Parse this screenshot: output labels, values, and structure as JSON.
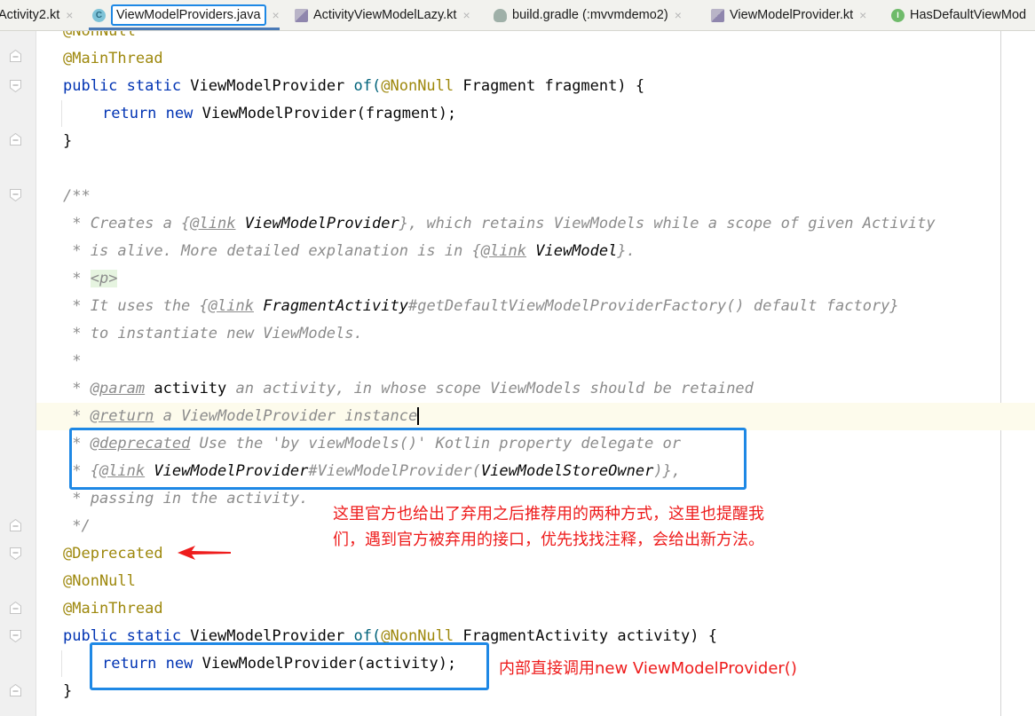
{
  "tabs": [
    {
      "label": "Activity2.kt",
      "icon": "kotlin-file-icon",
      "active": false
    },
    {
      "label": "ViewModelProviders.java",
      "icon": "java-class-icon",
      "active": true
    },
    {
      "label": "ActivityViewModelLazy.kt",
      "icon": "kotlin-file-icon",
      "active": false
    },
    {
      "label": "build.gradle (:mvvmdemo2)",
      "icon": "gradle-icon",
      "active": false
    },
    {
      "label": "ViewModelProvider.kt",
      "icon": "kotlin-file-icon",
      "active": false
    },
    {
      "label": "HasDefaultViewMod",
      "icon": "interface-icon",
      "active": false
    }
  ],
  "tab_close_glyph": "×",
  "icon_letters": {
    "class": "C",
    "interface": "I"
  },
  "code": {
    "l0": "@NonNull",
    "l1": "@MainThread",
    "l2": {
      "kw": "public static ",
      "type": "ViewModelProvider ",
      "fn": "of(",
      "ann": "@NonNull ",
      "rest": "Fragment fragment) {"
    },
    "l3": {
      "kw": "return new ",
      "rest": "ViewModelProvider(fragment);"
    },
    "l4": "}",
    "l6": "/**",
    "l7": {
      "a": " * Creates a {",
      "tag": "@link",
      "sp": " ",
      "ref": "ViewModelProvider",
      "b": "}, which retains ViewModels while a scope of given Activity"
    },
    "l8": {
      "a": " * is alive. More detailed explanation is in {",
      "tag": "@link",
      "sp": " ",
      "ref": "ViewModel",
      "b": "}."
    },
    "l9": {
      "a": " * ",
      "html": "<p>"
    },
    "l10": {
      "a": " * It uses the {",
      "tag": "@link",
      "sp": " ",
      "ref": "FragmentActivity",
      "b": "#getDefaultViewModelProviderFactory() default factory}"
    },
    "l11": " * to instantiate new ViewModels.",
    "l12": " *",
    "l13": {
      "a": " * ",
      "tag": "@param",
      "sp": " ",
      "ref": "activity",
      "b": " an activity, in whose scope ViewModels should be retained"
    },
    "l14": {
      "a": " * ",
      "tag": "@return",
      "b": " a ViewModelProvider instance"
    },
    "l15": {
      "a": " * ",
      "tag": "@deprecated",
      "b": " Use the 'by viewModels()' Kotlin property delegate or"
    },
    "l16": {
      "a": " * {",
      "tag": "@link",
      "sp": " ",
      "ref": "ViewModelProvider",
      "b": "#ViewModelProvider(",
      "ref2": "ViewModelStoreOwner",
      "c": ")},"
    },
    "l17": " * passing in the activity.",
    "l18": " */",
    "l19": "@Deprecated",
    "l20": "@NonNull",
    "l21": "@MainThread",
    "l22": {
      "kw": "public static ",
      "type": "ViewModelProvider ",
      "fn": "of(",
      "ann": "@NonNull ",
      "rest": "FragmentActivity activity) {"
    },
    "l23": {
      "kw": "return new ",
      "rest": "ViewModelProvider(activity);"
    },
    "l24": "}"
  },
  "annotations": {
    "note1_line1": "这里官方也给出了弃用之后推荐用的两种方式，这里也提醒我",
    "note1_line2": "们，遇到官方被弃用的接口，优先找找注释，会给出新方法。",
    "note2": "内部直接调用new ViewModelProvider()"
  },
  "colors": {
    "highlight_box": "#1e88e5",
    "annotation_text": "#ee1c1c",
    "keyword": "#0033b3",
    "annotation": "#9e880d",
    "comment": "#8c8c8c"
  }
}
